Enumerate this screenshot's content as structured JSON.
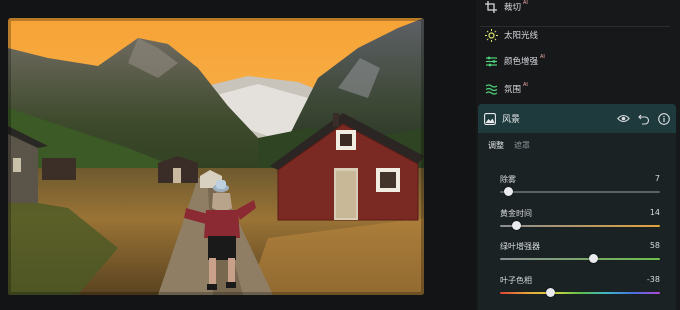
{
  "tools": [
    {
      "label": "裁切",
      "ai": "AI",
      "icon": "crop-icon"
    },
    {
      "label": "太阳光线",
      "ai": "",
      "icon": "sun-rays-icon"
    },
    {
      "label": "颜色增强",
      "ai": "AI",
      "icon": "color-enhance-icon"
    },
    {
      "label": "氛围",
      "ai": "AI",
      "icon": "atmosphere-icon"
    }
  ],
  "feature": {
    "title": "风景",
    "icon": "landscape-icon",
    "tabs": [
      "调整",
      "遮罩"
    ],
    "active_tab": 0
  },
  "sliders": [
    {
      "label": "除雾",
      "value": "7",
      "level": 0.05,
      "track": "#5c6068"
    },
    {
      "label": "黄金时间",
      "value": "14",
      "level": 0.1,
      "track": "golden"
    },
    {
      "label": "绿叶增强器",
      "value": "58",
      "level": 0.58,
      "track": "green"
    },
    {
      "label": "叶子色相",
      "value": "-38",
      "level": 0.31,
      "track": "rainbow"
    }
  ],
  "colors": {
    "panel_bg": "#17181a",
    "card_header": "#1e3a3c",
    "ai_badge": "#f0a8a8"
  }
}
